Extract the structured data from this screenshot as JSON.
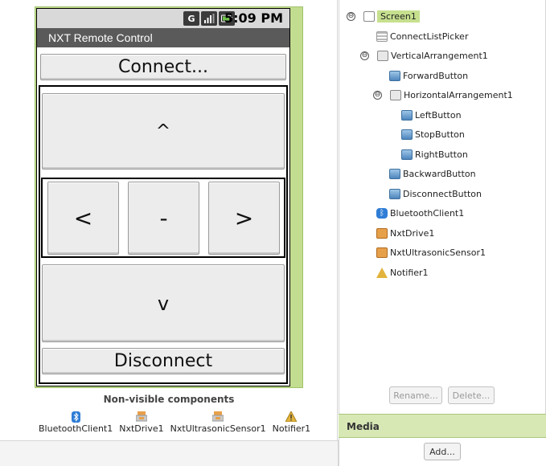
{
  "phone": {
    "status_time": "5:09 PM",
    "status_icons": [
      "G",
      "signal-bars",
      "battery"
    ],
    "app_title": "NXT Remote Control",
    "buttons": {
      "connect": "Connect...",
      "forward": "^",
      "left": "<",
      "stop": "-",
      "right": ">",
      "backward": "v",
      "disconnect": "Disconnect"
    }
  },
  "nonvisible": {
    "title": "Non-visible components",
    "items": [
      {
        "label": "BluetoothClient1",
        "icon": "bluetooth-icon"
      },
      {
        "label": "NxtDrive1",
        "icon": "nxt-icon"
      },
      {
        "label": "NxtUltrasonicSensor1",
        "icon": "nxt-icon"
      },
      {
        "label": "Notifier1",
        "icon": "warning-icon"
      }
    ]
  },
  "tree": {
    "screen": "Screen1",
    "connect_list_picker": "ConnectListPicker",
    "vertical_arrangement": "VerticalArrangement1",
    "forward_button": "ForwardButton",
    "horizontal_arrangement": "HorizontalArrangement1",
    "left_button": "LeftButton",
    "stop_button": "StopButton",
    "right_button": "RightButton",
    "backward_button": "BackwardButton",
    "disconnect_button": "DisconnectButton",
    "bluetooth_client": "BluetoothClient1",
    "nxt_drive": "NxtDrive1",
    "nxt_ultrasonic": "NxtUltrasonicSensor1",
    "notifier": "Notifier1",
    "collapse_symbol": "⊖"
  },
  "actions": {
    "rename": "Rename...",
    "delete": "Delete..."
  },
  "media": {
    "title": "Media",
    "add": "Add..."
  },
  "colors": {
    "selection": "#c6e08e",
    "panel_header": "#d7e8b5",
    "titlebar": "#5a5a5a"
  }
}
